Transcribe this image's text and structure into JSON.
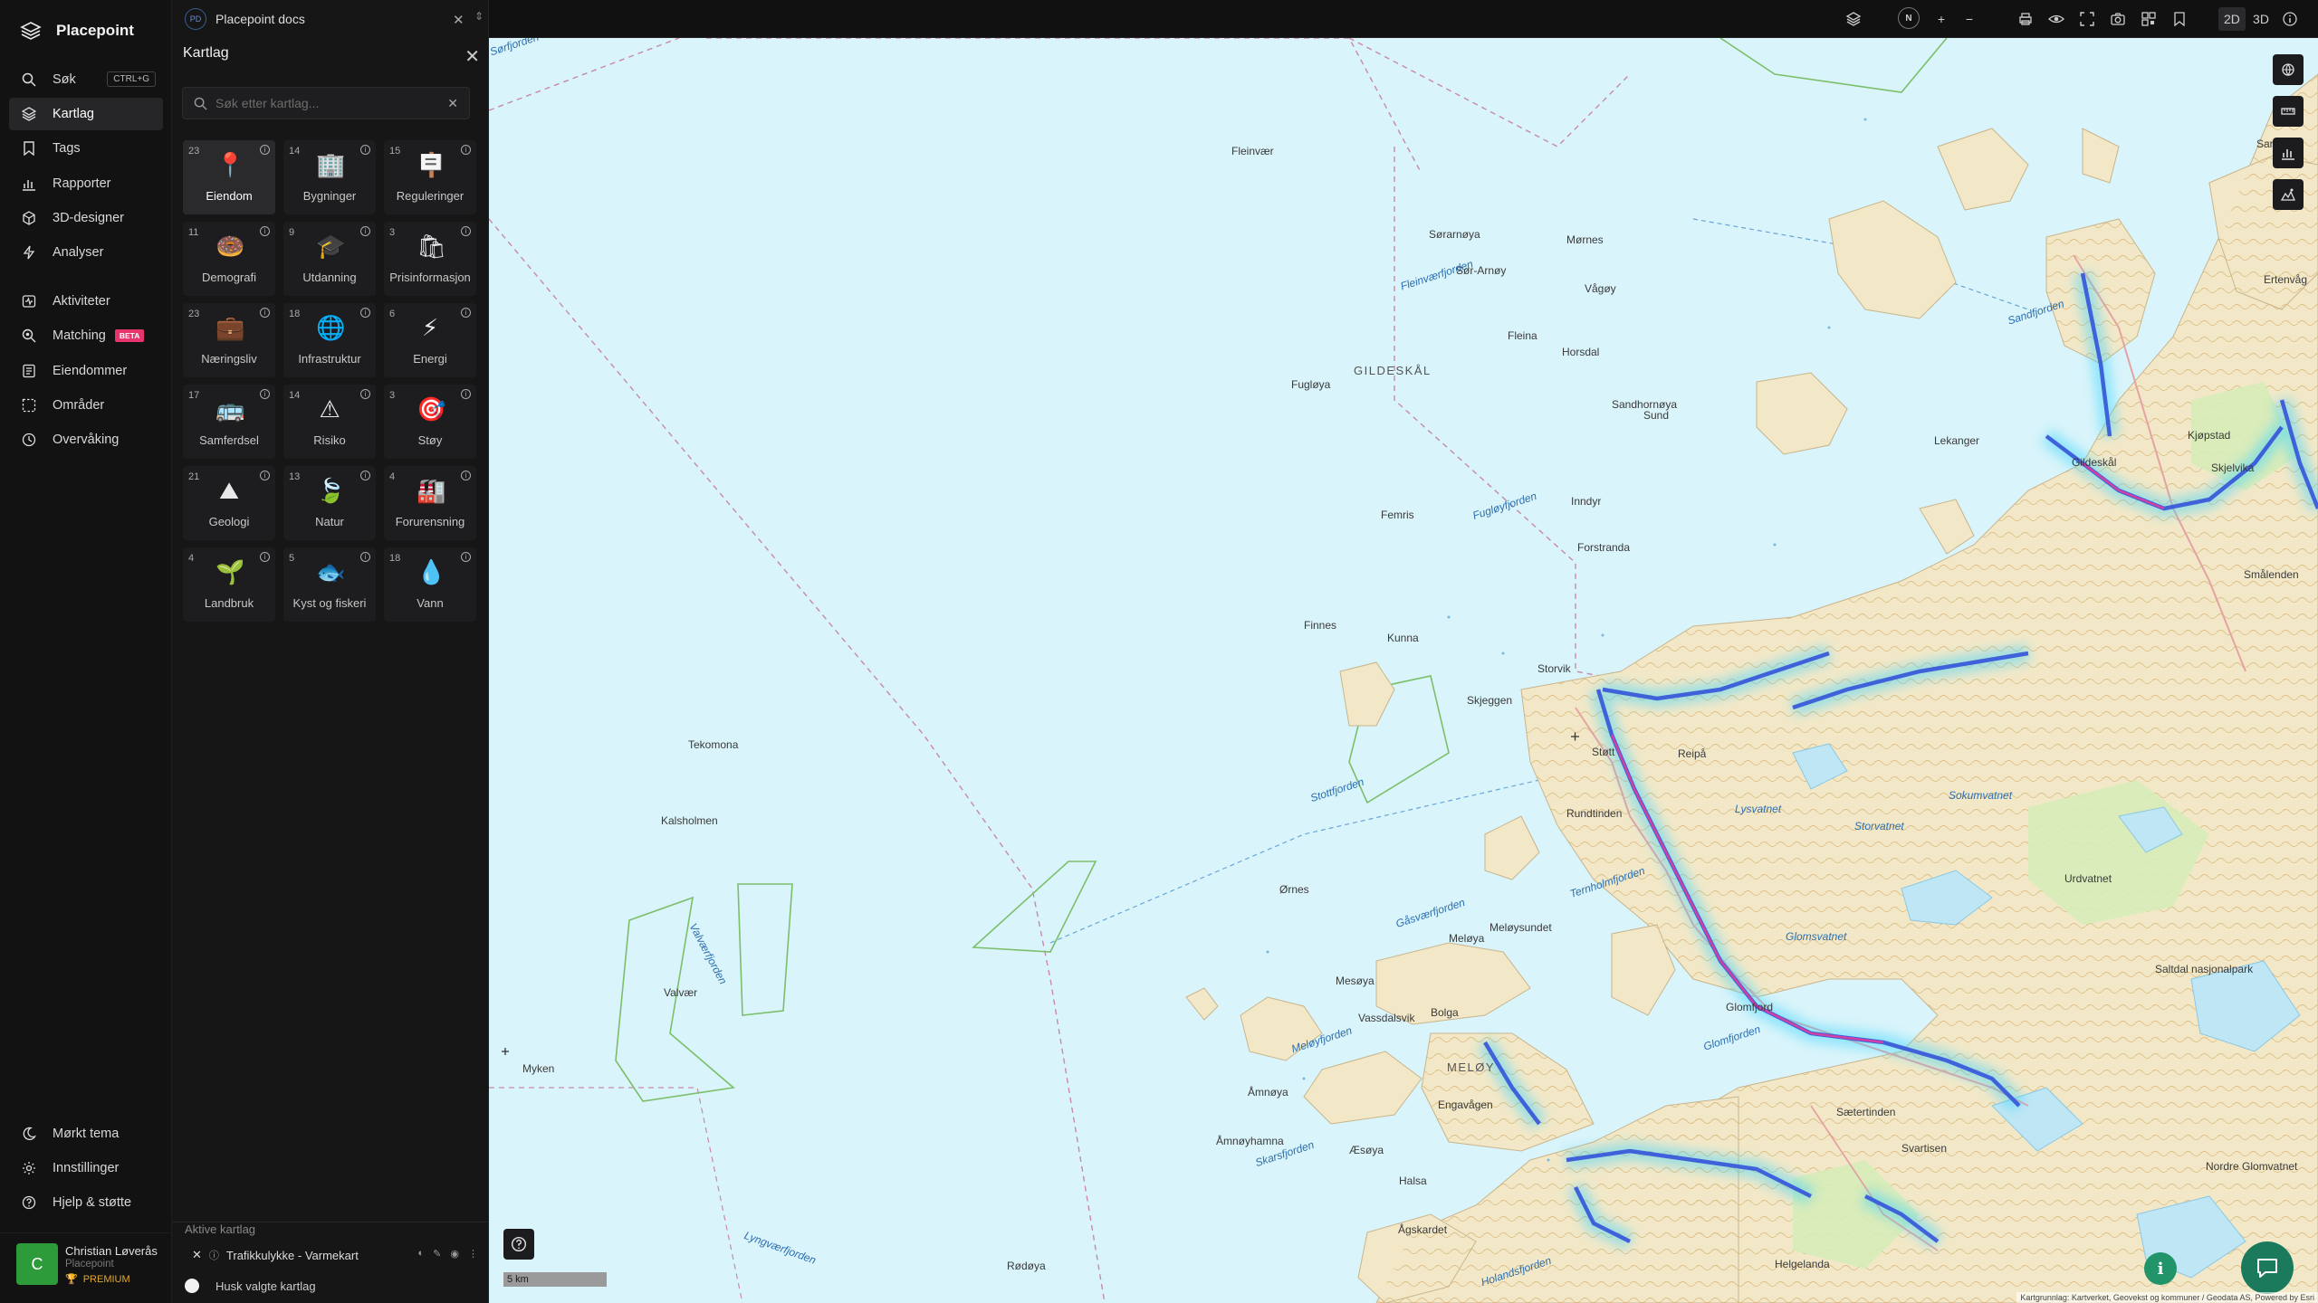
{
  "brand": {
    "name": "Placepoint"
  },
  "nav": {
    "items": [
      {
        "id": "sok",
        "label": "Søk",
        "shortcut": "CTRL+G"
      },
      {
        "id": "kartlag",
        "label": "Kartlag",
        "active": true
      },
      {
        "id": "tags",
        "label": "Tags"
      },
      {
        "id": "rapporter",
        "label": "Rapporter"
      },
      {
        "id": "designer",
        "label": "3D-designer"
      },
      {
        "id": "analyser",
        "label": "Analyser"
      },
      {
        "id": "aktiviteter",
        "label": "Aktiviteter"
      },
      {
        "id": "matching",
        "label": "Matching",
        "badge": "BETA"
      },
      {
        "id": "eiendommer",
        "label": "Eiendommer"
      },
      {
        "id": "omrader",
        "label": "Områder"
      },
      {
        "id": "overvaking",
        "label": "Overvåking"
      }
    ],
    "bottom": [
      {
        "id": "theme",
        "label": "Mørkt tema"
      },
      {
        "id": "settings",
        "label": "Innstillinger"
      },
      {
        "id": "help",
        "label": "Hjelp & støtte"
      }
    ]
  },
  "user": {
    "initial": "C",
    "name": "Christian Løverås",
    "org": "Placepoint",
    "plan": "PREMIUM"
  },
  "doc": {
    "badge": "PD",
    "title": "Placepoint docs"
  },
  "panel": {
    "title": "Kartlag",
    "search_placeholder": "Søk etter kartlag...",
    "categories": [
      {
        "count": "23",
        "label": "Eiendom",
        "icon": "pin-icon",
        "selected": true
      },
      {
        "count": "14",
        "label": "Bygninger",
        "icon": "building-icon"
      },
      {
        "count": "15",
        "label": "Reguleringer",
        "icon": "signpost-icon"
      },
      {
        "count": "11",
        "label": "Demografi",
        "icon": "donut-chart-icon"
      },
      {
        "count": "9",
        "label": "Utdanning",
        "icon": "graduation-icon"
      },
      {
        "count": "3",
        "label": "Prisinformasjon",
        "icon": "shopping-bag-icon"
      },
      {
        "count": "23",
        "label": "Næringsliv",
        "icon": "briefcase-icon"
      },
      {
        "count": "18",
        "label": "Infrastruktur",
        "icon": "globe-icon"
      },
      {
        "count": "6",
        "label": "Energi",
        "icon": "lightning-icon"
      },
      {
        "count": "17",
        "label": "Samferdsel",
        "icon": "bus-icon"
      },
      {
        "count": "14",
        "label": "Risiko",
        "icon": "hazard-icon"
      },
      {
        "count": "3",
        "label": "Støy",
        "icon": "noise-gauge-icon"
      },
      {
        "count": "21",
        "label": "Geologi",
        "icon": "terrain-icon"
      },
      {
        "count": "13",
        "label": "Natur",
        "icon": "leaf-icon"
      },
      {
        "count": "4",
        "label": "Forurensning",
        "icon": "factory-icon"
      },
      {
        "count": "4",
        "label": "Landbruk",
        "icon": "sprout-icon"
      },
      {
        "count": "5",
        "label": "Kyst og fiskeri",
        "icon": "fish-icon"
      },
      {
        "count": "18",
        "label": "Vann",
        "icon": "water-drop-icon"
      }
    ],
    "active_title": "Aktive kartlag",
    "active_layers": [
      {
        "label": "Trafikkulykke - Varmekart"
      }
    ],
    "remember_label": "Husk valgte kartlag"
  },
  "toolbar": {
    "compass": "N",
    "mode_2d": "2D",
    "mode_3d": "3D"
  },
  "map": {
    "scale_label": "5 km",
    "attribution": "Kartgrunnlag: Kartverket, Geovekst og kommuner / Geodata AS, Powered by Esri",
    "labels": [
      {
        "text": "Fleinvær",
        "kind": "place"
      },
      {
        "text": "Fleinværfjorden",
        "kind": "water"
      },
      {
        "text": "Fleina",
        "kind": "place"
      },
      {
        "text": "Sørarnøya",
        "kind": "place"
      },
      {
        "text": "Sør-Arnøy",
        "kind": "place"
      },
      {
        "text": "Mørnes",
        "kind": "place"
      },
      {
        "text": "Vågøy",
        "kind": "place"
      },
      {
        "text": "Horsdal",
        "kind": "place"
      },
      {
        "text": "GILDESKÅL",
        "kind": "region"
      },
      {
        "text": "Fugløya",
        "kind": "place"
      },
      {
        "text": "Sandhornøya",
        "kind": "place"
      },
      {
        "text": "Sund",
        "kind": "place"
      },
      {
        "text": "Inndyr",
        "kind": "place"
      },
      {
        "text": "Fugløyfjorden",
        "kind": "water"
      },
      {
        "text": "Forstranda",
        "kind": "place"
      },
      {
        "text": "Femris",
        "kind": "place"
      },
      {
        "text": "Finnes",
        "kind": "place"
      },
      {
        "text": "Kunna",
        "kind": "place"
      },
      {
        "text": "Storvik",
        "kind": "place"
      },
      {
        "text": "Skjeggen",
        "kind": "place"
      },
      {
        "text": "Støtt",
        "kind": "place"
      },
      {
        "text": "Reipå",
        "kind": "place"
      },
      {
        "text": "Rundtinden",
        "kind": "place"
      },
      {
        "text": "Stottfjorden",
        "kind": "water"
      },
      {
        "text": "Tekomona",
        "kind": "place"
      },
      {
        "text": "Kalsholmen",
        "kind": "place"
      },
      {
        "text": "Ternholmfjorden",
        "kind": "water"
      },
      {
        "text": "Ørnes",
        "kind": "place"
      },
      {
        "text": "Gåsværfjorden",
        "kind": "water"
      },
      {
        "text": "Meløya",
        "kind": "place"
      },
      {
        "text": "Meløysundet",
        "kind": "place"
      },
      {
        "text": "Mesøya",
        "kind": "place"
      },
      {
        "text": "Bolga",
        "kind": "place"
      },
      {
        "text": "Meløyfjorden",
        "kind": "water"
      },
      {
        "text": "Valvær",
        "kind": "place"
      },
      {
        "text": "Valværfjorden",
        "kind": "water"
      },
      {
        "text": "Myken",
        "kind": "place"
      },
      {
        "text": "Vassdalsvik",
        "kind": "place"
      },
      {
        "text": "Glomfjord",
        "kind": "place"
      },
      {
        "text": "Glomfjorden",
        "kind": "water"
      },
      {
        "text": "Ågskardet",
        "kind": "place"
      },
      {
        "text": "MELØY",
        "kind": "region"
      },
      {
        "text": "Engavågen",
        "kind": "place"
      },
      {
        "text": "Åmnøya",
        "kind": "place"
      },
      {
        "text": "Åmnøyhamna",
        "kind": "place"
      },
      {
        "text": "Skarsfjorden",
        "kind": "water"
      },
      {
        "text": "Halsa",
        "kind": "place"
      },
      {
        "text": "Æsøya",
        "kind": "place"
      },
      {
        "text": "Sætertinden",
        "kind": "place"
      },
      {
        "text": "Svartisen",
        "kind": "place"
      },
      {
        "text": "Lyngværfjorden",
        "kind": "water"
      },
      {
        "text": "Rødøya",
        "kind": "place"
      },
      {
        "text": "Holandsfjorden",
        "kind": "water"
      },
      {
        "text": "Helgelanda",
        "kind": "place"
      },
      {
        "text": "Urdvatnet",
        "kind": "place"
      },
      {
        "text": "Saltdal nasjonalpark",
        "kind": "place"
      },
      {
        "text": "Lysvatnet",
        "kind": "water"
      },
      {
        "text": "Storvatnet",
        "kind": "water"
      },
      {
        "text": "Sokumvatnet",
        "kind": "water"
      },
      {
        "text": "Glomsvatnet",
        "kind": "water"
      },
      {
        "text": "Nordre Glomvatnet",
        "kind": "place"
      },
      {
        "text": "Sandvika",
        "kind": "place"
      },
      {
        "text": "Ertenvåg",
        "kind": "place"
      },
      {
        "text": "Kjøpstad",
        "kind": "place"
      },
      {
        "text": "Skjelvika",
        "kind": "place"
      },
      {
        "text": "Smålenden",
        "kind": "place"
      },
      {
        "text": "Sandfjorden",
        "kind": "water"
      },
      {
        "text": "Lekanger",
        "kind": "place"
      },
      {
        "text": "Gildeskål",
        "kind": "place"
      },
      {
        "text": "Sørfjorden",
        "kind": "water"
      }
    ]
  },
  "colors": {
    "accent": "#2e9b3a",
    "beta": "#e8346c",
    "premium": "#e1a82b",
    "sea": "#d9f4fa",
    "land": "#f2e8c8",
    "heat": "#3a5bd9"
  }
}
